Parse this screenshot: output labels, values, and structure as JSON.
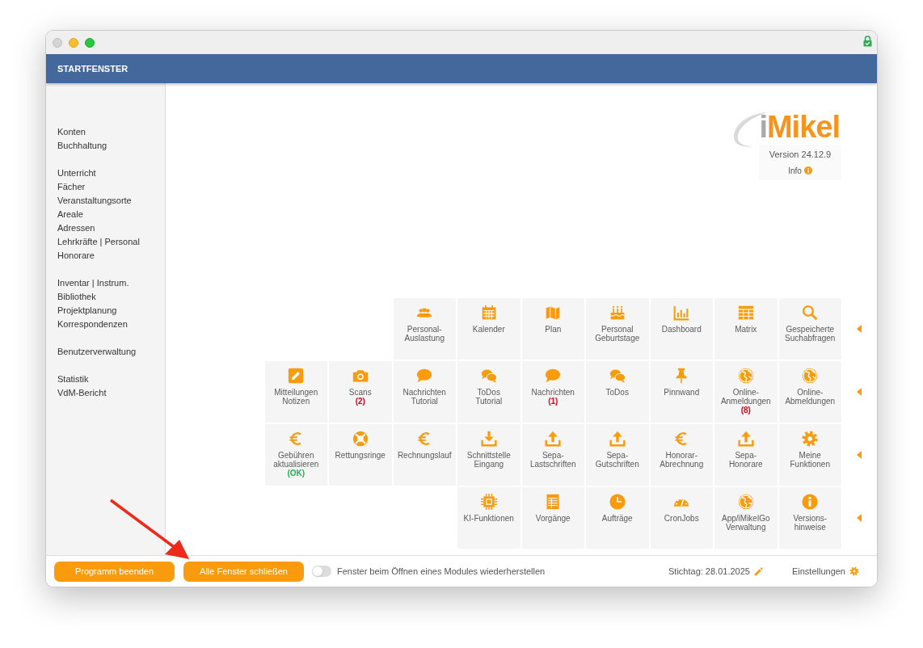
{
  "window": {
    "title": "STARTFENSTER"
  },
  "sidebar": {
    "groups": [
      {
        "items": [
          "Konten",
          "Buchhaltung"
        ]
      },
      {
        "items": [
          "Unterricht",
          "Fächer",
          "Veranstaltungsorte",
          "Areale",
          "Adressen",
          "Lehrkräfte | Personal",
          "Honorare"
        ]
      },
      {
        "items": [
          "Inventar | Instrum.",
          "Bibliothek",
          "Projektplanung",
          "Korrespondenzen"
        ]
      },
      {
        "items": [
          "Benutzerverwaltung"
        ]
      },
      {
        "items": [
          "Statistik",
          "VdM-Bericht"
        ]
      }
    ]
  },
  "logo": {
    "name": "iMikel",
    "version": "Version 24.12.9",
    "info": "Info"
  },
  "tile_rows": [
    {
      "tiles": [
        {
          "kind": "people",
          "label": "Personal-\nAuslastung"
        },
        {
          "kind": "calendar",
          "label": "Kalender"
        },
        {
          "kind": "map",
          "label": "Plan"
        },
        {
          "kind": "cake",
          "label": "Personal\nGeburtstage"
        },
        {
          "kind": "chart",
          "label": "Dashboard"
        },
        {
          "kind": "table",
          "label": "Matrix"
        },
        {
          "kind": "search",
          "label": "Gespeicherte\nSuchabfragen"
        }
      ]
    },
    {
      "tiles": [
        {
          "kind": "edit",
          "label": "Mitteilungen\nNotizen"
        },
        {
          "kind": "camera",
          "label": "Scans",
          "badge": {
            "text": "(2)",
            "color": "#e0001b"
          }
        },
        {
          "kind": "chat",
          "label": "Nachrichten\nTutorial"
        },
        {
          "kind": "chats",
          "label": "ToDos\nTutorial"
        },
        {
          "kind": "chat",
          "label": "Nachrichten",
          "badge": {
            "text": "(1)",
            "color": "#e0001b"
          }
        },
        {
          "kind": "chats",
          "label": "ToDos"
        },
        {
          "kind": "pin",
          "label": "Pinnwand"
        },
        {
          "kind": "globe",
          "label": "Online-\nAnmeldungen",
          "badge": {
            "text": "(8)",
            "color": "#e0001b"
          }
        },
        {
          "kind": "globe",
          "label": "Online-\nAbmeldungen"
        }
      ]
    },
    {
      "tiles": [
        {
          "kind": "euro",
          "label": "Gebühren\naktualisieren",
          "badge": {
            "text": "(OK)",
            "color": "#22b14c"
          }
        },
        {
          "kind": "lifebuoy",
          "label": "Rettungsringe"
        },
        {
          "kind": "euro",
          "label": "Rechnungslauf"
        },
        {
          "kind": "download",
          "label": "Schnittstelle\nEingang"
        },
        {
          "kind": "upload",
          "label": "Sepa-\nLastschriften"
        },
        {
          "kind": "upload",
          "label": "Sepa-\nGutschriften"
        },
        {
          "kind": "euro",
          "label": "Honorar-\nAbrechnung"
        },
        {
          "kind": "upload",
          "label": "Sepa-\nHonorare"
        },
        {
          "kind": "gear",
          "label": "Meine\nFunktionen"
        }
      ]
    },
    {
      "tiles": [
        {
          "kind": "chip",
          "label": "KI-Funktionen"
        },
        {
          "kind": "sheet",
          "label": "Vorgänge"
        },
        {
          "kind": "clock",
          "label": "Aufträge"
        },
        {
          "kind": "gauge",
          "label": "CronJobs"
        },
        {
          "kind": "globe",
          "label": "App/iMikelGo\nVerwaltung"
        },
        {
          "kind": "info",
          "label": "Versions-\nhinweise"
        }
      ]
    }
  ],
  "footer": {
    "buttons": [
      "Programm beenden",
      "Alle Fenster schließen"
    ],
    "restore_toggle": {
      "on": false,
      "label": "Fenster beim Öffnen eines Modules wiederherstellen"
    },
    "key_date": "Stichtag: 28.01.2025",
    "settings": "Einstellungen"
  },
  "annotation": {
    "kind": "arrow"
  }
}
